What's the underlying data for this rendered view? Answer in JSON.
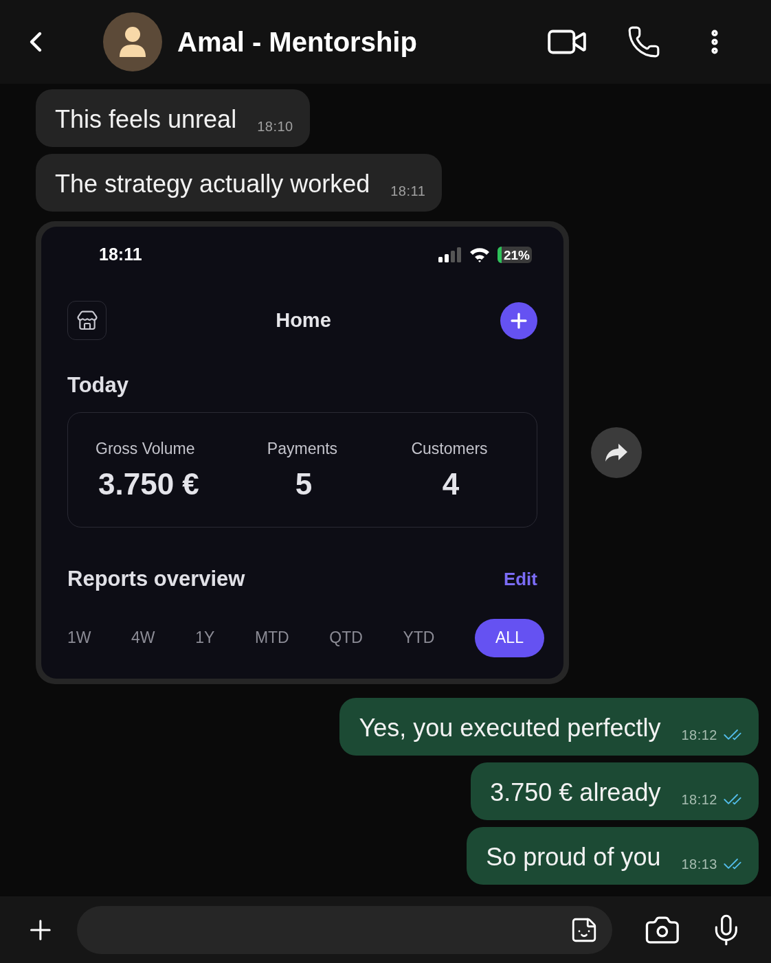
{
  "header": {
    "title": "Amal - Mentorship"
  },
  "messages": [
    {
      "kind": "text",
      "outgoing": false,
      "text": "This feels unreal",
      "time": "18:10"
    },
    {
      "kind": "text",
      "outgoing": false,
      "text": "The strategy actually worked",
      "time": "18:11"
    },
    {
      "kind": "screenshot",
      "outgoing": false,
      "screenshot": {
        "status_time": "18:11",
        "battery": "21%",
        "title": "Home",
        "section": "Today",
        "stats": [
          {
            "label": "Gross Volume",
            "value": "3.750 €"
          },
          {
            "label": "Payments",
            "value": "5"
          },
          {
            "label": "Customers",
            "value": "4"
          }
        ],
        "reports_title": "Reports overview",
        "edit_link": "Edit",
        "ranges": [
          {
            "label": "1W",
            "selected": false
          },
          {
            "label": "4W",
            "selected": false
          },
          {
            "label": "1Y",
            "selected": false
          },
          {
            "label": "MTD",
            "selected": false
          },
          {
            "label": "QTD",
            "selected": false
          },
          {
            "label": "YTD",
            "selected": false
          },
          {
            "label": "ALL",
            "selected": true
          }
        ]
      }
    },
    {
      "kind": "text",
      "outgoing": true,
      "text": "Yes, you executed perfectly",
      "time": "18:12",
      "read": true
    },
    {
      "kind": "text",
      "outgoing": true,
      "text": "3.750 € already",
      "time": "18:12",
      "read": true
    },
    {
      "kind": "text",
      "outgoing": true,
      "text": "So proud of you",
      "time": "18:13",
      "read": true
    }
  ]
}
